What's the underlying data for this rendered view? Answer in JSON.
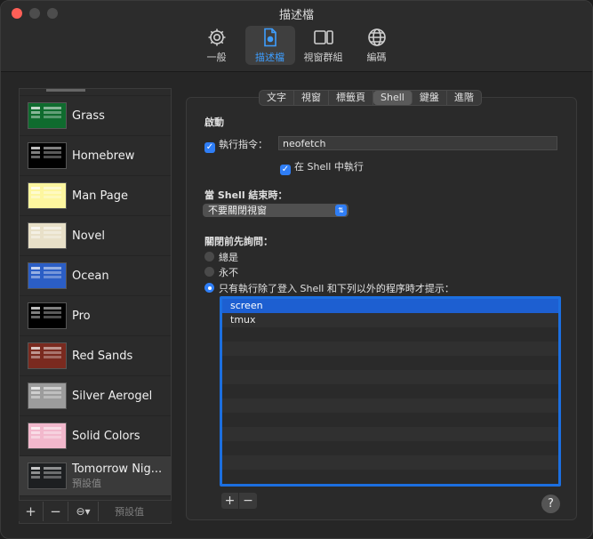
{
  "window": {
    "title": "描述檔"
  },
  "toolbar": [
    {
      "label": "一般",
      "icon": "gear-icon"
    },
    {
      "label": "描述檔",
      "icon": "profile-document-icon",
      "active": true
    },
    {
      "label": "視窗群組",
      "icon": "window-groups-icon"
    },
    {
      "label": "編碼",
      "icon": "globe-icon"
    }
  ],
  "profiles": [
    {
      "name": "Grass",
      "color": "#0f6b2e"
    },
    {
      "name": "Homebrew",
      "color": "#000000"
    },
    {
      "name": "Man Page",
      "color": "#fdf69f"
    },
    {
      "name": "Novel",
      "color": "#e8e0c8"
    },
    {
      "name": "Ocean",
      "color": "#2b5ec5"
    },
    {
      "name": "Pro",
      "color": "#000000"
    },
    {
      "name": "Red Sands",
      "color": "#7a2a1f"
    },
    {
      "name": "Silver Aerogel",
      "color": "#9c9c9c"
    },
    {
      "name": "Solid Colors",
      "color": "#f2b8cc"
    },
    {
      "name": "Tomorrow Nig...",
      "sub": "預設值",
      "color": "#1d1f21",
      "selected": true
    }
  ],
  "sidebar_footer": {
    "add": "+",
    "remove": "−",
    "more": "⊖▾",
    "default": "預設值"
  },
  "tabs": [
    "文字",
    "視窗",
    "標籤頁",
    "Shell",
    "鍵盤",
    "進階"
  ],
  "active_tab": "Shell",
  "startup": {
    "heading": "啟動",
    "run_command_label": "執行指令：",
    "run_command_value": "neofetch",
    "run_in_shell_label": "在 Shell 中執行"
  },
  "on_exit": {
    "heading": "當 Shell 結束時：",
    "selected": "不要關閉視窗"
  },
  "ask_before_close": {
    "heading": "關閉前先詢問：",
    "options": [
      "總是",
      "永不",
      "只有執行除了登入 Shell 和下列以外的程序時才提示："
    ],
    "selected_index": 2
  },
  "process_list": [
    "screen",
    "tmux"
  ],
  "list_buttons": {
    "add": "+",
    "remove": "−"
  },
  "help": "?"
}
